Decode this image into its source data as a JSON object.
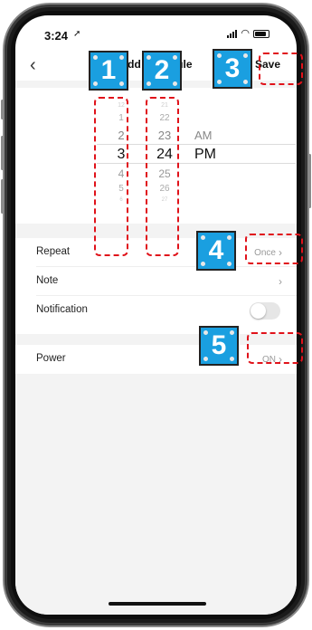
{
  "status_bar": {
    "time": "3:24"
  },
  "nav": {
    "title": "Add Schedule",
    "save_label": "Save"
  },
  "picker": {
    "hours": [
      "12",
      "1",
      "2",
      "3",
      "4",
      "5",
      "6"
    ],
    "minutes": [
      "21",
      "22",
      "23",
      "24",
      "25",
      "26",
      "27"
    ],
    "selected_hour": "3",
    "selected_minute": "24",
    "period_options": [
      "AM",
      "PM"
    ],
    "selected_period": "PM"
  },
  "rows": {
    "repeat": {
      "label": "Repeat",
      "value": "Once"
    },
    "note": {
      "label": "Note"
    },
    "notification": {
      "label": "Notification",
      "enabled": false
    },
    "power": {
      "label": "Power",
      "value": "ON"
    }
  },
  "annotations": [
    "1",
    "2",
    "3",
    "4",
    "5"
  ],
  "colors": {
    "annotation_box": "#e0121a",
    "annotation_badge": "#1a9fe0"
  }
}
